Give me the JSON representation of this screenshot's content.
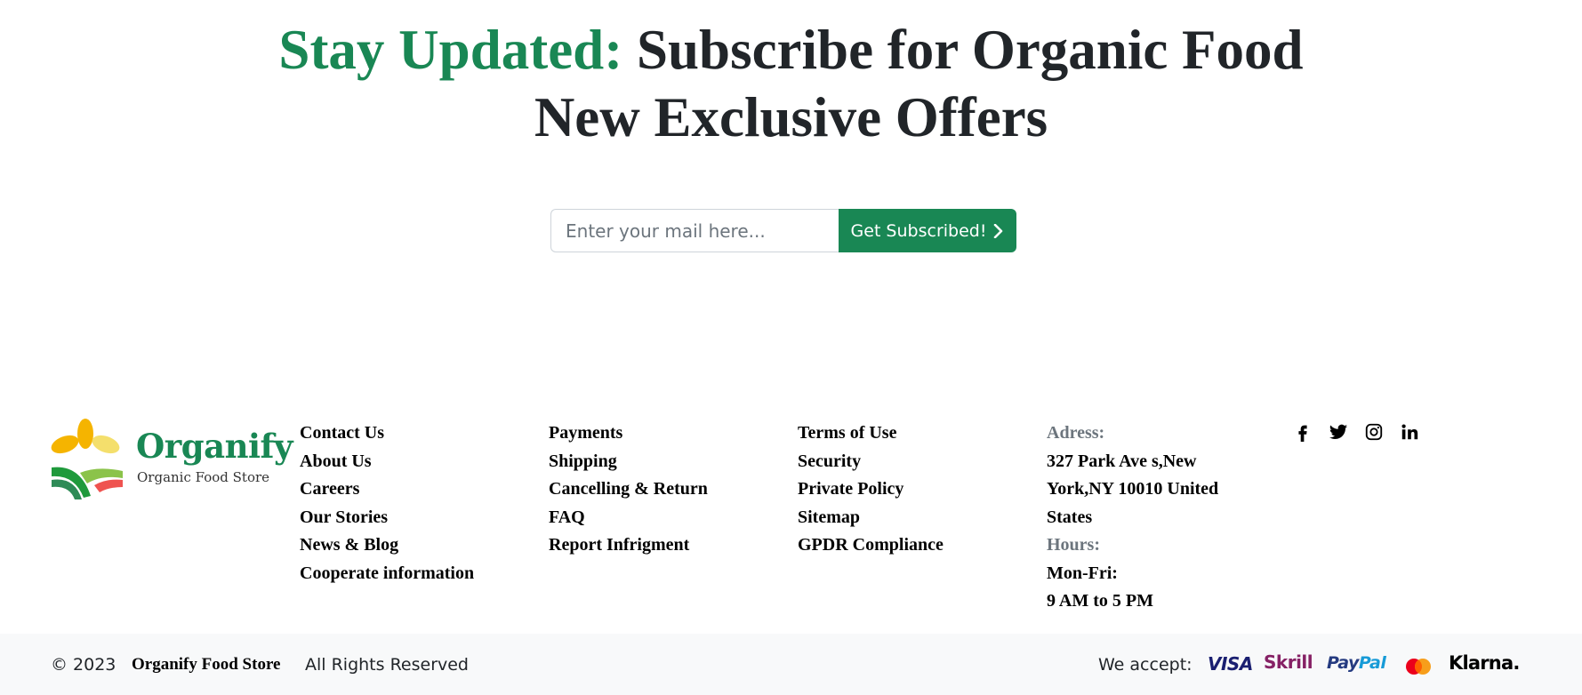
{
  "newsletter": {
    "title_accent": "Stay Updated:",
    "title_rest": " Subscribe for Organic Food",
    "title_line2": "New Exclusive Offers",
    "email_placeholder": "Enter your mail here...",
    "email_value": "",
    "button_label": "Get Subscribed!",
    "button_icon": "chevron-right-icon"
  },
  "brand": {
    "name": "Organify",
    "tagline": "Organic Food Store",
    "logo_icon": "leaf-field-logo",
    "color": "#198754"
  },
  "footer": {
    "columns": [
      [
        "Contact Us",
        "About Us",
        "Careers",
        "Our Stories",
        "News & Blog",
        "Cooperate information"
      ],
      [
        "Payments",
        "Shipping",
        "Cancelling & Return",
        "FAQ",
        "Report Infrigment"
      ],
      [
        "Terms of Use",
        "Security",
        "Private Policy",
        "Sitemap",
        "GPDR Compliance"
      ]
    ],
    "contact": {
      "address_label": "Adress:",
      "address_lines": [
        "327 Park Ave s,New",
        "York,NY 10010 United",
        "States"
      ],
      "hours_label": "Hours:",
      "hours_lines": [
        "Mon-Fri:",
        "9 AM to 5 PM"
      ]
    },
    "social_icons": [
      "facebook-icon",
      "twitter-icon",
      "instagram-icon",
      "linkedin-icon"
    ]
  },
  "bottom_bar": {
    "copyright": "© 2023",
    "brand": "Organify Food Store",
    "rights": "All Rights Reserved",
    "we_accept": "We accept:",
    "payments": {
      "visa": "VISA",
      "skrill": "Skrill",
      "paypal_pay": "Pay",
      "paypal_pal": "Pal",
      "mastercard": "mastercard-icon",
      "klarna": "Klarna."
    }
  },
  "colors": {
    "accent": "#198754",
    "text": "#212529",
    "muted": "#6c757d",
    "bottom_bar_bg": "#f8f9fa"
  }
}
